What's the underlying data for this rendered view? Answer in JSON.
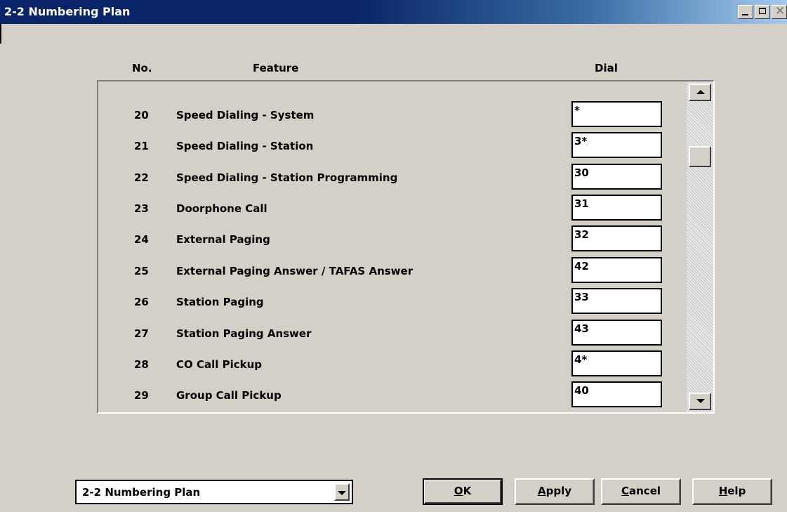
{
  "window": {
    "title": "2-2 Numbering Plan",
    "controls": [
      "minimize-icon",
      "maximize-icon",
      "close-icon"
    ]
  },
  "columns": {
    "no": "No.",
    "feature": "Feature",
    "dial": "Dial"
  },
  "rows": [
    {
      "no": "20",
      "feature": "Speed Dialing - System",
      "dial": "*"
    },
    {
      "no": "21",
      "feature": "Speed Dialing - Station",
      "dial": "3*"
    },
    {
      "no": "22",
      "feature": "Speed Dialing - Station Programming",
      "dial": "30"
    },
    {
      "no": "23",
      "feature": "Doorphone Call",
      "dial": "31"
    },
    {
      "no": "24",
      "feature": "External Paging",
      "dial": "32"
    },
    {
      "no": "25",
      "feature": "External Paging Answer / TAFAS Answer",
      "dial": "42"
    },
    {
      "no": "26",
      "feature": "Station Paging",
      "dial": "33"
    },
    {
      "no": "27",
      "feature": "Station Paging Answer",
      "dial": "43"
    },
    {
      "no": "28",
      "feature": "CO Call Pickup",
      "dial": "4*"
    },
    {
      "no": "29",
      "feature": "Group Call Pickup",
      "dial": "40"
    }
  ],
  "footer": {
    "page_select": "2-2 Numbering Plan",
    "ok": {
      "label": "OK",
      "accel_char": "O",
      "rest": "K"
    },
    "apply": {
      "label": "Apply",
      "accel_char": "A",
      "rest": "pply"
    },
    "cancel": {
      "label": "Cancel",
      "accel_char": "C",
      "rest": "ancel"
    },
    "help": {
      "label": "Help",
      "accel_char": "H",
      "rest": "elp"
    }
  },
  "colors": {
    "face": "#d4d0c8",
    "title_active": "#0a246a"
  }
}
